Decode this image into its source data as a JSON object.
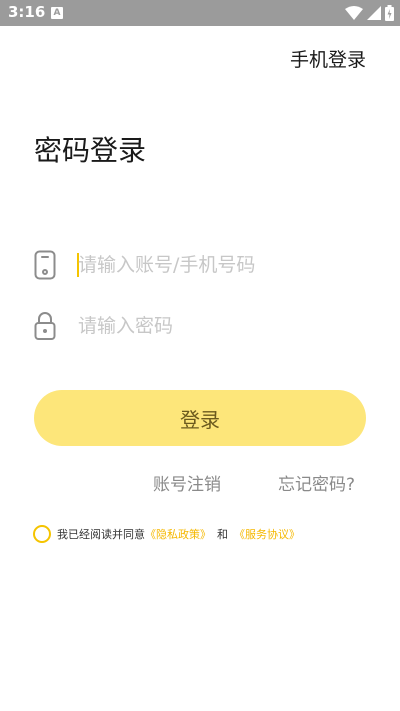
{
  "status_bar": {
    "time": "3:16",
    "app_icon_letter": "A"
  },
  "header": {
    "phone_login_link": "手机登录"
  },
  "title": "密码登录",
  "form": {
    "account_placeholder": "请输入账号/手机号码",
    "password_placeholder": "请输入密码",
    "login_button": "登录"
  },
  "links": {
    "cancel_account": "账号注销",
    "forgot_password": "忘记密码?"
  },
  "agreement": {
    "prefix": "我已经阅读并同意",
    "privacy_policy": "《隐私政策》",
    "and": "和",
    "service_agreement": "《服务协议》"
  },
  "colors": {
    "accent": "#f5c400",
    "button_bg": "#fde67a",
    "status_bar": "#9b9b9b"
  }
}
